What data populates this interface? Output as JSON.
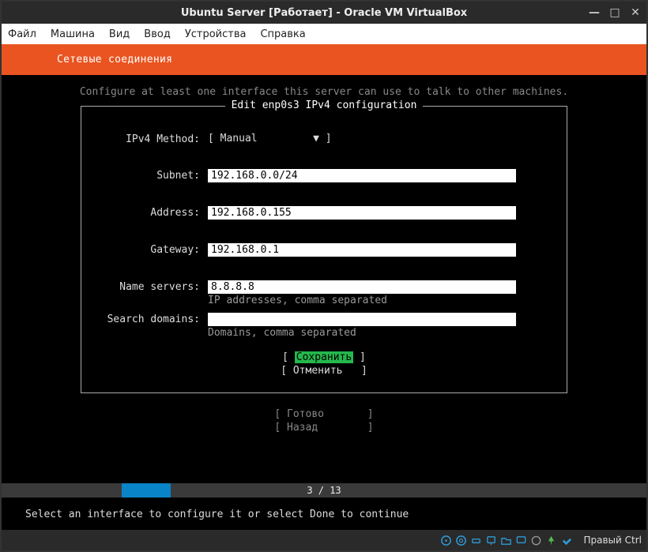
{
  "virtualbox": {
    "title": "Ubuntu Server [Работает] - Oracle VM VirtualBox",
    "controls": {
      "min": "—",
      "max": "□",
      "close": "✕"
    },
    "menu": [
      "Файл",
      "Машина",
      "Вид",
      "Ввод",
      "Устройства",
      "Справка"
    ],
    "hostkey": "Правый Ctrl"
  },
  "header": {
    "title": "Сетевые соединения"
  },
  "hint_above": "Configure at least one interface this server can use to talk to other machines.",
  "panel": {
    "title": "Edit enp0s3 IPv4 configuration",
    "method_label": "IPv4 Method:",
    "method_value": "Manual",
    "fields": {
      "subnet": {
        "label": "Subnet:",
        "value": "192.168.0.0/24"
      },
      "address": {
        "label": "Address:",
        "value": "192.168.0.155"
      },
      "gateway": {
        "label": "Gateway:",
        "value": "192.168.0.1"
      },
      "nameservers": {
        "label": "Name servers:",
        "value": "8.8.8.8",
        "help": "IP addresses, comma separated"
      },
      "searchdomains": {
        "label": "Search domains:",
        "value": "",
        "help": "Domains, comma separated"
      }
    },
    "save_btn": "Сохранить",
    "cancel_btn": "Отменить"
  },
  "back": {
    "done": "Готово",
    "back": "Назад"
  },
  "progress": {
    "text": "3 / 13"
  },
  "bottom_hint": "Select an interface to configure it or select Done to continue"
}
